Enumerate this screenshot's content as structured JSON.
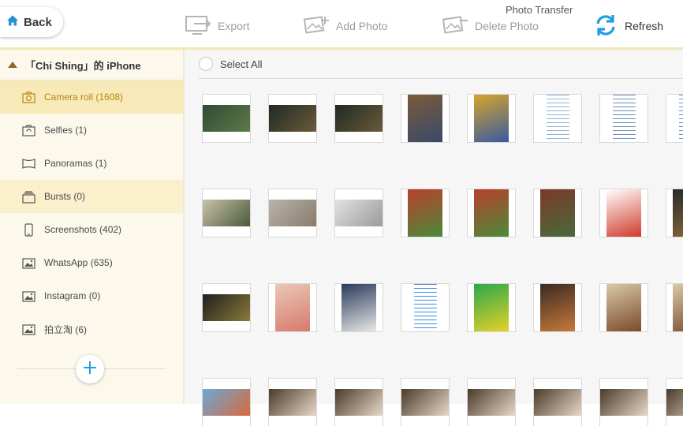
{
  "toolbar": {
    "back_label": "Back",
    "export_label": "Export",
    "add_photo_label": "Add Photo",
    "delete_photo_label": "Delete Photo",
    "refresh_label": "Refresh",
    "app_title": "Photo Transfer"
  },
  "sidebar": {
    "device_name": "「Chi Shing」的 iPhone",
    "albums": [
      {
        "label": "Camera roll (1608)",
        "icon": "camera-icon",
        "state": "active"
      },
      {
        "label": "Selfies (1)",
        "icon": "selfie-camera-icon",
        "state": ""
      },
      {
        "label": "Panoramas (1)",
        "icon": "panorama-icon",
        "state": ""
      },
      {
        "label": "Bursts (0)",
        "icon": "burst-icon",
        "state": "hl"
      },
      {
        "label": "Screenshots (402)",
        "icon": "phone-icon",
        "state": ""
      },
      {
        "label": "WhatsApp (635)",
        "icon": "image-icon",
        "state": ""
      },
      {
        "label": "Instagram (0)",
        "icon": "image-icon",
        "state": ""
      },
      {
        "label": "拍立淘 (6)",
        "icon": "image-icon",
        "state": ""
      }
    ]
  },
  "main": {
    "select_all_label": "Select All"
  },
  "photos": [
    {
      "kind": "wide",
      "colors": [
        "#2f4a36",
        "#5e7a48"
      ]
    },
    {
      "kind": "wide",
      "colors": [
        "#1f2a22",
        "#6b5a3a"
      ]
    },
    {
      "kind": "wide",
      "colors": [
        "#1f2a22",
        "#6b5a3a"
      ]
    },
    {
      "kind": "tall",
      "colors": [
        "#7a5a3a",
        "#3a4a6a"
      ]
    },
    {
      "kind": "tall",
      "colors": [
        "#d4a52a",
        "#3a5aa0"
      ]
    },
    {
      "kind": "doc",
      "colors": [
        "#ffffff",
        "#8fb3d8"
      ]
    },
    {
      "kind": "doc",
      "colors": [
        "#ffffff",
        "#6a8fb8"
      ]
    },
    {
      "kind": "doc",
      "colors": [
        "#ffffff",
        "#6a8fb8"
      ]
    },
    {
      "kind": "wide",
      "colors": [
        "#c9c2a8",
        "#4a5a3a"
      ]
    },
    {
      "kind": "wide",
      "colors": [
        "#b8b4ac",
        "#8a7a6a"
      ]
    },
    {
      "kind": "wide",
      "colors": [
        "#e2e2e2",
        "#9a9a9a"
      ]
    },
    {
      "kind": "tall",
      "colors": [
        "#b8402a",
        "#4a8a3a"
      ]
    },
    {
      "kind": "tall",
      "colors": [
        "#b8402a",
        "#4a8a3a"
      ]
    },
    {
      "kind": "tall",
      "colors": [
        "#7a3a2a",
        "#4a6a3a"
      ]
    },
    {
      "kind": "tall",
      "colors": [
        "#ffffff",
        "#d03a2a"
      ]
    },
    {
      "kind": "tall",
      "colors": [
        "#2a2a2a",
        "#8a6a3a"
      ]
    },
    {
      "kind": "wide",
      "colors": [
        "#1f1f1f",
        "#8a7a3a"
      ]
    },
    {
      "kind": "tall",
      "colors": [
        "#e8c8b8",
        "#d87a6a"
      ]
    },
    {
      "kind": "tall",
      "colors": [
        "#2a3a5a",
        "#e8e8e8"
      ]
    },
    {
      "kind": "doc",
      "colors": [
        "#ffffff",
        "#3a8ad8"
      ]
    },
    {
      "kind": "tall",
      "colors": [
        "#2aa84a",
        "#e8d02a"
      ]
    },
    {
      "kind": "tall",
      "colors": [
        "#3a2a22",
        "#c87a3a"
      ]
    },
    {
      "kind": "tall",
      "colors": [
        "#d8c8a8",
        "#7a4a2a"
      ]
    },
    {
      "kind": "tall",
      "colors": [
        "#d8c8a8",
        "#7a4a2a"
      ]
    },
    {
      "kind": "wide",
      "colors": [
        "#6aa8d8",
        "#d86a3a"
      ]
    },
    {
      "kind": "wide",
      "colors": [
        "#4a3a2a",
        "#e8d8c8"
      ]
    },
    {
      "kind": "wide",
      "colors": [
        "#4a3a2a",
        "#e8d8c8"
      ]
    },
    {
      "kind": "wide",
      "colors": [
        "#4a3a2a",
        "#e8d8c8"
      ]
    },
    {
      "kind": "wide",
      "colors": [
        "#4a3a2a",
        "#e8d8c8"
      ]
    },
    {
      "kind": "wide",
      "colors": [
        "#4a3a2a",
        "#e8d8c8"
      ]
    },
    {
      "kind": "wide",
      "colors": [
        "#4a3a2a",
        "#e8d8c8"
      ]
    },
    {
      "kind": "wide",
      "colors": [
        "#4a3a2a",
        "#e8d8c8"
      ]
    }
  ]
}
